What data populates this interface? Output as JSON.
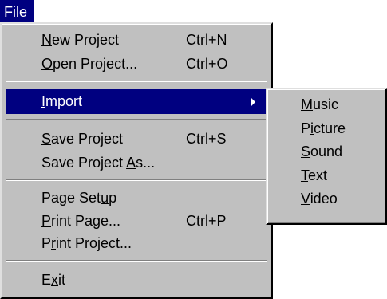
{
  "menubar": {
    "file": {
      "before": "",
      "accel": "F",
      "after": "ile"
    }
  },
  "file_menu": {
    "new_project": {
      "before": "",
      "accel": "N",
      "after": "ew Project",
      "shortcut": "Ctrl+N"
    },
    "open_project": {
      "before": "",
      "accel": "O",
      "after": "pen Project...",
      "shortcut": "Ctrl+O"
    },
    "import": {
      "before": "",
      "accel": "I",
      "after": "mport"
    },
    "save_project": {
      "before": "",
      "accel": "S",
      "after": "ave Project",
      "shortcut": "Ctrl+S"
    },
    "save_project_as": {
      "before": "Save Project ",
      "accel": "A",
      "after": "s..."
    },
    "page_setup": {
      "before": "Page Set",
      "accel": "u",
      "after": "p"
    },
    "print_page": {
      "before": "",
      "accel": "P",
      "after": "rint Page...",
      "shortcut": "Ctrl+P"
    },
    "print_project": {
      "before": "P",
      "accel": "r",
      "after": "int Project..."
    },
    "exit": {
      "before": "E",
      "accel": "x",
      "after": "it"
    }
  },
  "import_submenu": {
    "music": {
      "before": "",
      "accel": "M",
      "after": "usic"
    },
    "picture": {
      "before": "P",
      "accel": "i",
      "after": "cture"
    },
    "sound": {
      "before": "",
      "accel": "S",
      "after": "ound"
    },
    "text": {
      "before": "",
      "accel": "T",
      "after": "ext"
    },
    "video": {
      "before": "",
      "accel": "V",
      "after": "ideo"
    }
  },
  "colors": {
    "menu_face": "#c0c0c0",
    "highlight": "#000080",
    "highlight_text": "#ffffff",
    "text": "#000000"
  }
}
